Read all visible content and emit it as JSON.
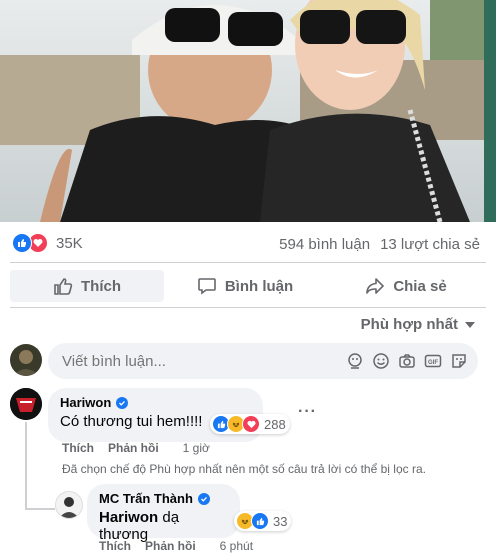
{
  "post": {
    "reaction_count": "35K",
    "comment_count": "594 bình luận",
    "share_count": "13 lượt chia sẻ"
  },
  "actions": {
    "like": "Thích",
    "comment": "Bình luận",
    "share": "Chia sẻ"
  },
  "sort": {
    "label": "Phù hợp nhất"
  },
  "composer": {
    "placeholder": "Viết bình luận..."
  },
  "comments": [
    {
      "author": "Hariwon",
      "text": "Có thương tui hem!!!!",
      "reaction_count": "288",
      "like_label": "Thích",
      "reply_label": "Phản hồi",
      "time": "1 giờ"
    }
  ],
  "filter_note": "Đã chọn chế độ Phù hợp nhất nên một số câu trả lời có thể bị lọc ra.",
  "replies": [
    {
      "author": "MC Trấn Thành",
      "mention": "Hariwon",
      "text": "dạ thương",
      "reaction_count": "33",
      "like_label": "Thích",
      "reply_label": "Phản hồi",
      "time": "6 phút"
    }
  ],
  "colors": {
    "accent": "#1877f2",
    "love": "#f33e58",
    "haha": "#f7b928",
    "muted": "#65676b",
    "bubble": "#f0f2f5"
  },
  "icons": [
    "like-icon",
    "love-icon",
    "haha-icon",
    "thumb-icon",
    "comment-icon",
    "share-arrow-icon",
    "caret-down-icon",
    "avatar-sticker-icon",
    "emoji-icon",
    "camera-icon",
    "gif-icon",
    "sticker-icon",
    "verified-icon"
  ]
}
